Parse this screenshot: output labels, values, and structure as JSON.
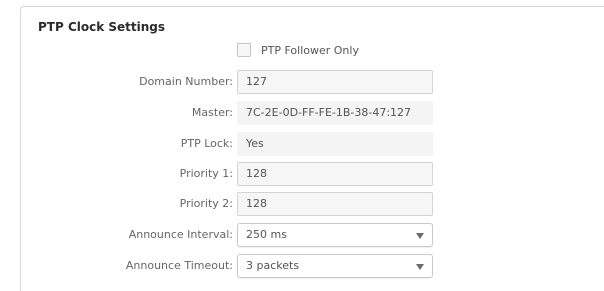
{
  "section": {
    "title": "PTP Clock Settings"
  },
  "follower_only": {
    "label": "PTP Follower Only",
    "checked": false
  },
  "rows": [
    {
      "label": "Domain Number:",
      "value": "127"
    },
    {
      "label": "Master:",
      "value": "7C-2E-0D-FF-FE-1B-38-47:127"
    },
    {
      "label": "PTP Lock:",
      "value": "Yes"
    },
    {
      "label": "Priority 1:",
      "value": "128"
    },
    {
      "label": "Priority 2:",
      "value": "128"
    },
    {
      "label": "Announce Interval:",
      "value": "250 ms"
    },
    {
      "label": "Announce Timeout:",
      "value": "3 packets"
    }
  ],
  "icons": {
    "dropdown": "chevron-down-icon"
  }
}
